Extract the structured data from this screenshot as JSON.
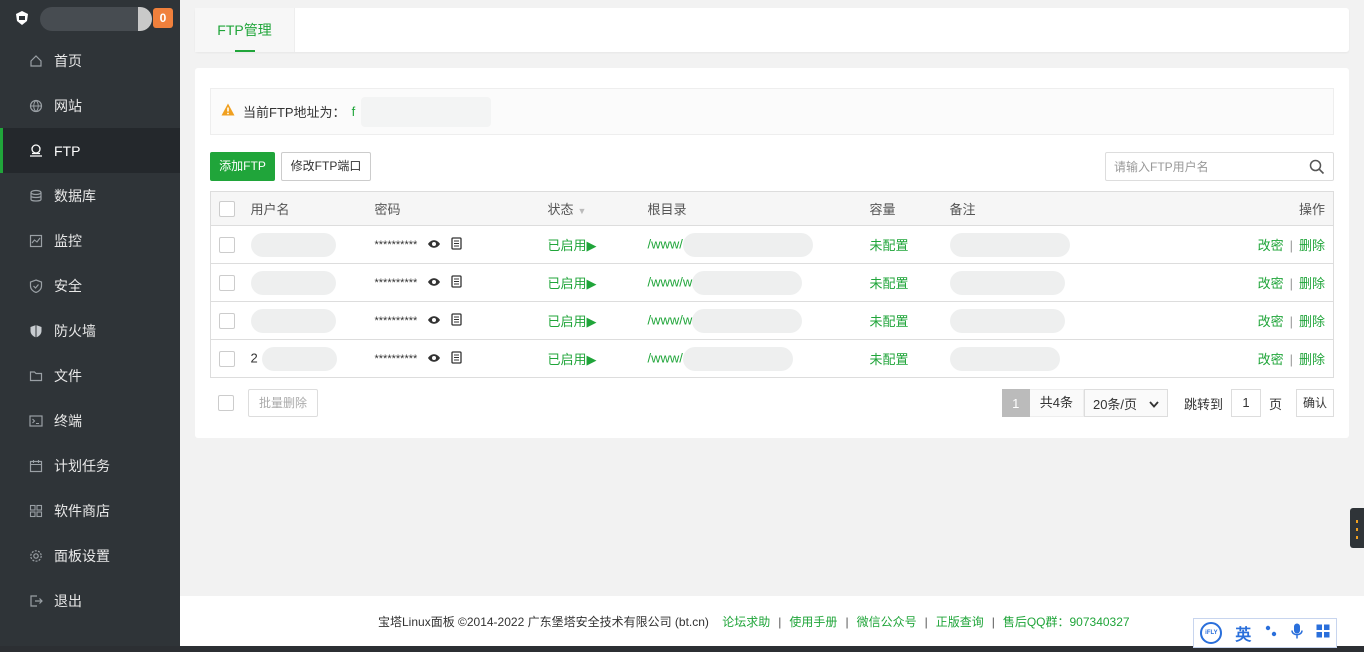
{
  "sidebar": {
    "badge": "0",
    "items": [
      {
        "label": "首页",
        "icon": "home-icon"
      },
      {
        "label": "网站",
        "icon": "globe-icon"
      },
      {
        "label": "FTP",
        "icon": "ftp-icon",
        "active": true
      },
      {
        "label": "数据库",
        "icon": "database-icon"
      },
      {
        "label": "监控",
        "icon": "monitor-icon"
      },
      {
        "label": "安全",
        "icon": "shield-check-icon"
      },
      {
        "label": "防火墙",
        "icon": "firewall-icon"
      },
      {
        "label": "文件",
        "icon": "folder-icon"
      },
      {
        "label": "终端",
        "icon": "terminal-icon"
      },
      {
        "label": "计划任务",
        "icon": "calendar-icon"
      },
      {
        "label": "软件商店",
        "icon": "grid-icon"
      },
      {
        "label": "面板设置",
        "icon": "gear-icon"
      },
      {
        "label": "退出",
        "icon": "logout-icon"
      }
    ]
  },
  "tab": {
    "label": "FTP管理"
  },
  "notice": {
    "text": "当前FTP地址为：",
    "addr": "f"
  },
  "toolbar": {
    "add_label": "添加FTP",
    "port_label": "修改FTP端口",
    "search_placeholder": "请输入FTP用户名"
  },
  "table": {
    "headers": {
      "user": "用户名",
      "password": "密码",
      "status": "状态",
      "path": "根目录",
      "size": "容量",
      "note": "备注",
      "op": "操作"
    },
    "rows": [
      {
        "user": "",
        "password": "**********",
        "status": "已启用▶",
        "path": "/www/",
        "size": "未配置",
        "note": "",
        "edit": "改密",
        "delete": "删除"
      },
      {
        "user": "",
        "password": "**********",
        "status": "已启用▶",
        "path": "/www/w",
        "size": "未配置",
        "note": "",
        "edit": "改密",
        "delete": "删除"
      },
      {
        "user": "",
        "password": "**********",
        "status": "已启用▶",
        "path": "/www/w",
        "size": "未配置",
        "note": "",
        "edit": "改密",
        "delete": "删除"
      },
      {
        "user": "2",
        "password": "**********",
        "status": "已启用▶",
        "path": "/www/",
        "size": "未配置",
        "note": "",
        "edit": "改密",
        "delete": "删除"
      }
    ]
  },
  "footer_bar": {
    "batch_delete": "批量删除",
    "page_current": "1",
    "total": "共4条",
    "page_size": "20条/页",
    "jump_label": "跳转到",
    "jump_value": "1",
    "page_unit": "页",
    "confirm": "确认"
  },
  "page_footer": {
    "copyright": "宝塔Linux面板 ©2014-2022 广东堡塔安全技术有限公司 (bt.cn)",
    "forum": "论坛求助",
    "manual": "使用手册",
    "wechat": "微信公众号",
    "genuine": "正版查询",
    "qq": "售后QQ群：907340327"
  },
  "ime": {
    "mode": "英"
  },
  "colors": {
    "accent": "#20a53a",
    "sidebar": "#2f3438",
    "warning": "#f0a020",
    "badge": "#f0803c"
  }
}
